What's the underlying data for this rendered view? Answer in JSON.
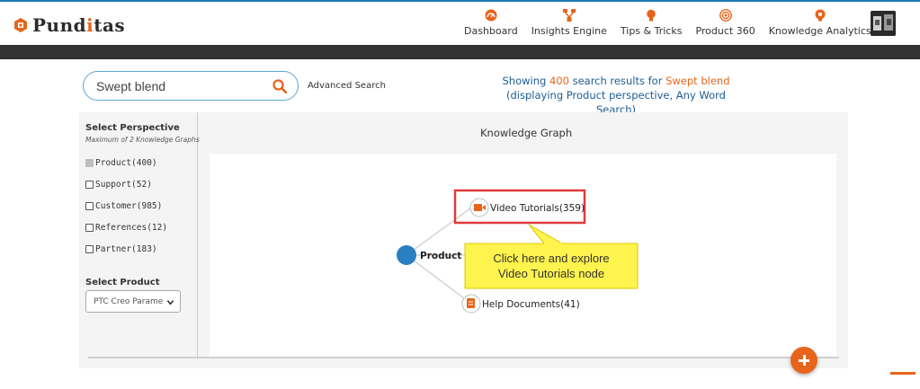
{
  "brand": {
    "prefix": "Pund",
    "accent": "i",
    "suffix": "tas",
    "accent_color": "#e8641b"
  },
  "nav": [
    {
      "label": "Dashboard",
      "icon": "gauge-icon"
    },
    {
      "label": "Insights Engine",
      "icon": "network-icon"
    },
    {
      "label": "Tips & Tricks",
      "icon": "lightbulb-icon"
    },
    {
      "label": "Product 360",
      "icon": "target-icon"
    },
    {
      "label": "Knowledge Analytics",
      "icon": "brain-icon"
    }
  ],
  "search": {
    "value": "Swept blend",
    "advanced_label": "Advanced Search"
  },
  "results": {
    "prefix": "Showing ",
    "count": "400",
    "middle": " search results for ",
    "query": "Swept blend",
    "line2": "(displaying Product perspective, Any Word Search)"
  },
  "perspective": {
    "title": "Select Perspective",
    "subtitle": "Maximum of 2 Knowledge Graphs",
    "items": [
      {
        "label": "Product(400)",
        "checked": true
      },
      {
        "label": "Support(52)",
        "checked": false
      },
      {
        "label": "Customer(985)",
        "checked": false
      },
      {
        "label": "References(12)",
        "checked": false
      },
      {
        "label": "Partner(183)",
        "checked": false
      }
    ]
  },
  "product": {
    "title": "Select Product",
    "selected": "PTC Creo Parame"
  },
  "graph": {
    "title": "Knowledge Graph",
    "root_label": "Product",
    "nodes": [
      {
        "label": "Video Tutorials(359)",
        "icon": "video-camera-icon"
      },
      {
        "label": "Help Documents(41)",
        "icon": "document-icon"
      }
    ],
    "callout_line1": "Click here and explore",
    "callout_line2": "Video Tutorials node",
    "node_color": "#2a7fc1",
    "highlight_color": "#e03a3a",
    "callout_color": "#fff34d"
  }
}
